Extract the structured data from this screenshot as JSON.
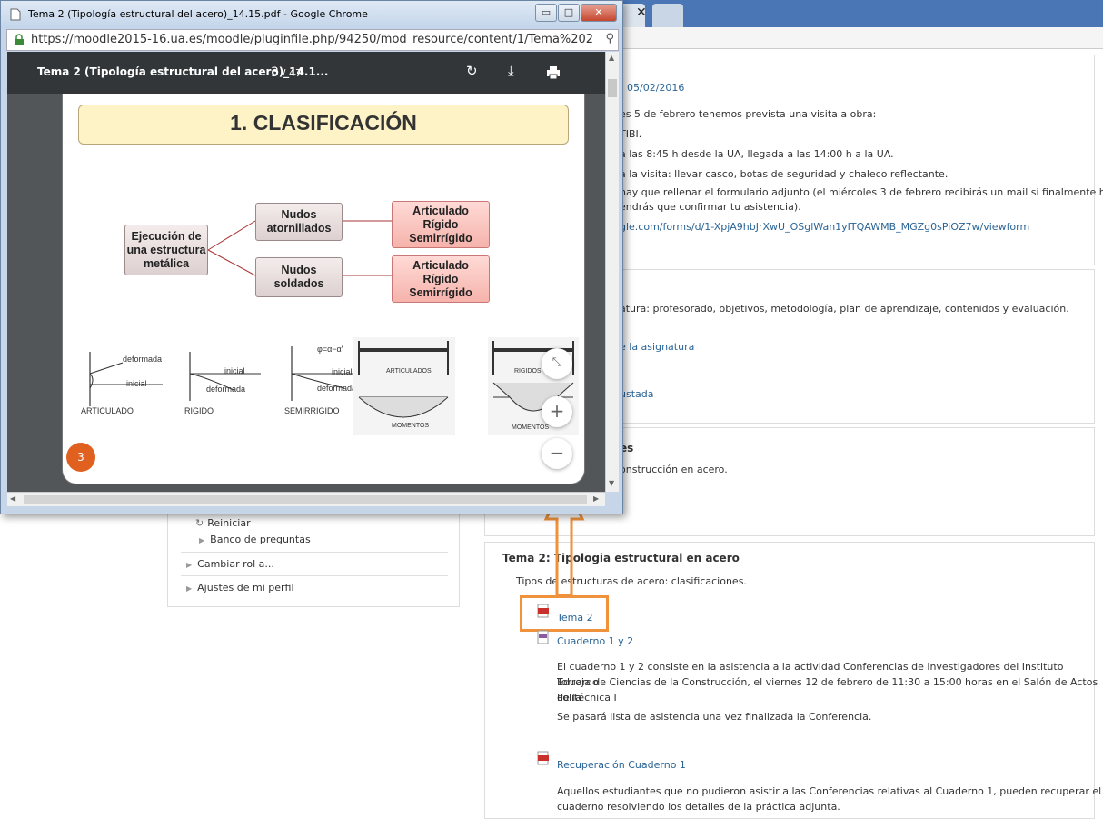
{
  "popup": {
    "window_title": "Tema 2 (Tipología estructural del acero)_14.15.pdf - Google Chrome",
    "minimize": "▭",
    "maximize": "□",
    "close": "✕",
    "url": "https://moodle2015-16.ua.es/moodle/pluginfile.php/94250/mod_resource/content/1/Tema%202(",
    "pdf_title": "Tema 2 (Tipología estructural del acero)_14.1...",
    "current_page": "3",
    "page_total": "/ 47",
    "page_badge": "3"
  },
  "slide": {
    "title": "1. CLASIFICACIÓN",
    "root_node": "Ejecución de una estructura metálica",
    "nudos_atornillados": "Nudos atornillados",
    "nudos_soldados": "Nudos soldados",
    "tipo_1": "Articulado",
    "tipo_2": "Rígido",
    "tipo_3": "Semirrígido",
    "label_articulado": "ARTICULADO",
    "label_rigido": "RIGIDO",
    "label_semirrigido": "SEMIRRIGIDO",
    "label_deformada": "deformada",
    "label_inicial": "inicial",
    "label_articulados": "ARTICULADOS",
    "label_rigidos": "RIGIDOS",
    "label_momentos": "MOMENTOS"
  },
  "moodle": {
    "date_link": "05/02/2016",
    "news_line1": "es 5 de febrero tenemos prevista una visita a obra:",
    "news_line2": "TIBI.",
    "news_line3": "a las 8:45 h desde la UA, llegada a las 14:00 h a la UA.",
    "news_line4": "a la visita: llevar casco, botas de seguridad y chaleco reflectante.",
    "news_line5": "hay que rellenar el formulario adjunto (el miércoles 3 de febrero recibirás un mail si finalmente has",
    "news_line6": "endrás que confirmar tu asistencia).",
    "form_link": "gle.com/forms/d/1-XpjA9hbJrXwU_OSglWan1yITQAWMB_MGZg0sPiOZ7w/viewform",
    "asig_line": "atura: profesorado, objetivos, metodología, plan de aprendizaje, contenidos y evaluación.",
    "asig_link": "e la asignatura",
    "ajustada_link": "ustada",
    "tema1_title_fragment": "es",
    "tema1_desc": "onstrucción en acero.",
    "tema2_title": "Tema 2: Tipologia estructural en acero",
    "tema2_desc": "Tipos de estructuras de acero: clasificaciones.",
    "tema2_file": "Tema 2",
    "cuaderno_link": "Cuaderno 1 y 2",
    "cuaderno_desc_1": "El cuaderno 1 y 2 consiste en la asistencia a la actividad Conferencias de investigadores del Instituto Eduardo",
    "cuaderno_desc_2": "Torroja de Ciencias de la Construcción, el viernes 12 de febrero de 11:30 a 15:00 horas en el Salón de Actos de la",
    "cuaderno_desc_3": "Politécnica I",
    "cuaderno_desc_4": "Se pasará lista de asistencia una vez finalizada la Conferencia.",
    "recuperacion_link": "Recuperación Cuaderno 1",
    "recuperacion_desc_1": "Aquellos estudiantes que no pudieron asistir a las Conferencias relativas al Cuaderno 1, pueden recuperar el",
    "recuperacion_desc_2": "cuaderno resolviendo los detalles de la práctica adjunta."
  },
  "admin": {
    "reiniciar": "Reiniciar",
    "banco": "Banco de preguntas",
    "cambiar_rol": "Cambiar rol a...",
    "ajustes": "Ajustes de mi perfil"
  },
  "colors": {
    "accent_orange": "#f0923b",
    "link": "#2a6496",
    "pdf_toolbar": "#323639"
  }
}
